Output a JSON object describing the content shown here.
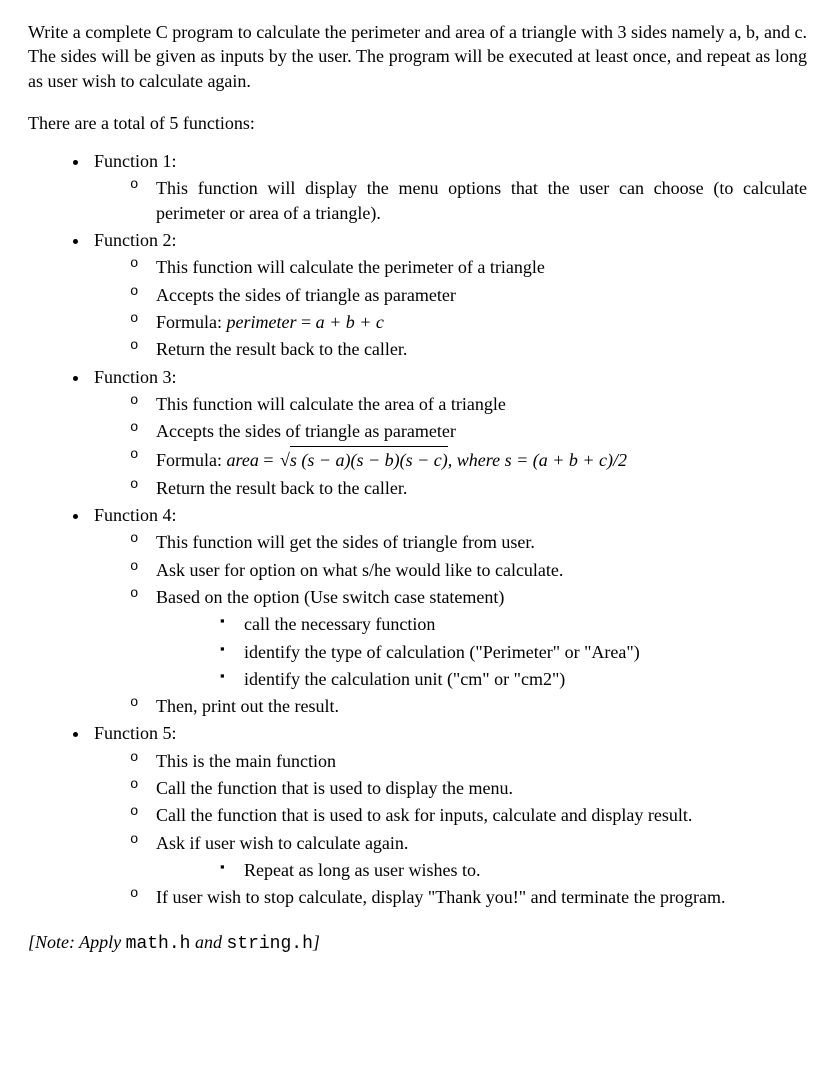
{
  "intro": "Write a complete C program to calculate the perimeter and area of a triangle with 3 sides namely a, b, and c. The sides will be given as inputs by the user. The program will be executed at least once, and repeat as long as user wish to calculate again.",
  "subhead": "There are a total of 5 functions:",
  "f1": {
    "title": "Function 1:",
    "items": [
      "This function will display the menu options that the user can choose (to calculate perimeter or area of a triangle)."
    ]
  },
  "f2": {
    "title": "Function 2:",
    "i0": "This function will calculate the perimeter of a triangle",
    "i1": "Accepts the sides of triangle as parameter",
    "formula_prefix": "Formula: ",
    "formula_lhs": "perimeter",
    "formula_eq": " = ",
    "formula_rhs": "a + b + c",
    "i3": "Return the result back to the caller."
  },
  "f3": {
    "title": "Function 3:",
    "i0": "This function will calculate the area of a triangle",
    "i1": "Accepts the sides of triangle as parameter",
    "formula_prefix": "Formula: ",
    "formula_lhs": "area",
    "formula_eq": " = ",
    "formula_sqrt_inner": "s (s − a)(s − b)(s − c)",
    "where": ",  where s = (a + b + c)/2",
    "i3": "Return the result back to the caller."
  },
  "f4": {
    "title": "Function 4:",
    "i0": "This function will get the sides of triangle from user.",
    "i1": "Ask user for option on what s/he would like to calculate.",
    "i2": "Based on the option (Use switch case statement)",
    "sub": [
      "call the necessary function",
      "identify the type of calculation (\"Perimeter\" or \"Area\")",
      "identify the calculation unit (\"cm\" or \"cm2\")"
    ],
    "i3": "Then, print out the result."
  },
  "f5": {
    "title": "Function 5:",
    "i0": "This is the main function",
    "i1": "Call the function that is used to display the menu.",
    "i2": "Call the function that is used to ask for inputs, calculate and display result.",
    "i3": "Ask if user wish to calculate again.",
    "sub": [
      "Repeat as long as user wishes to."
    ],
    "i4": "If user wish to stop calculate, display \"Thank you!\" and terminate the program."
  },
  "note": {
    "prefix": "[Note: Apply ",
    "code1": "math.h",
    "mid": " and ",
    "code2": "string.h",
    "suffix": "]"
  }
}
